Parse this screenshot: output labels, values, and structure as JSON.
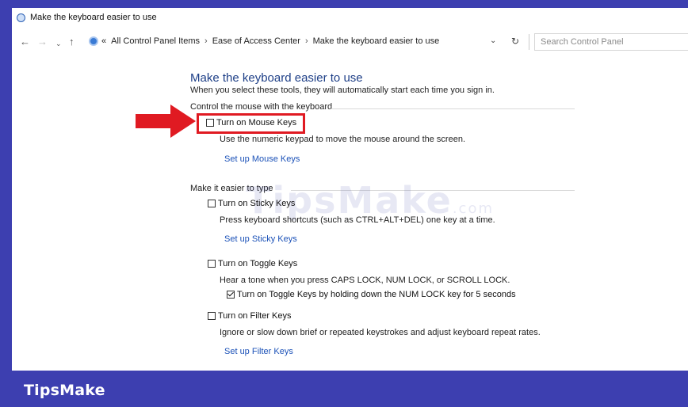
{
  "window": {
    "title": "Make the keyboard easier to use"
  },
  "nav": {
    "back_icon": "back-arrow-icon",
    "forward_icon": "forward-arrow-icon",
    "recent_icon": "chevron-down-icon",
    "up_icon": "up-arrow-icon"
  },
  "breadcrumb": {
    "overflow": "«",
    "items": [
      "All Control Panel Items",
      "Ease of Access Center",
      "Make the keyboard easier to use"
    ]
  },
  "search": {
    "placeholder": "Search Control Panel"
  },
  "page": {
    "title": "Make the keyboard easier to use",
    "description": "When you select these tools, they will automatically start each time you sign in."
  },
  "sections": {
    "mouse": {
      "heading": "Control the mouse with the keyboard",
      "mouse_keys": {
        "label": "Turn on Mouse Keys",
        "checked": false,
        "description": "Use the numeric keypad to move the mouse around the screen.",
        "link": "Set up Mouse Keys"
      }
    },
    "typing": {
      "heading": "Make it easier to type",
      "sticky_keys": {
        "label": "Turn on Sticky Keys",
        "checked": false,
        "description": "Press keyboard shortcuts (such as CTRL+ALT+DEL) one key at a time.",
        "link": "Set up Sticky Keys"
      },
      "toggle_keys": {
        "label": "Turn on Toggle Keys",
        "checked": false,
        "description": "Hear a tone when you press CAPS LOCK, NUM LOCK, or SCROLL LOCK.",
        "sub_option": {
          "label": "Turn on Toggle Keys by holding down the NUM LOCK key for 5 seconds",
          "checked": true
        }
      },
      "filter_keys": {
        "label": "Turn on Filter Keys",
        "checked": false,
        "description": "Ignore or slow down brief or repeated keystrokes and adjust keyboard repeat rates.",
        "link": "Set up Filter Keys"
      }
    }
  },
  "watermark": {
    "text": "TipsMake",
    "suffix": ".com"
  },
  "footer": {
    "brand": "TipsMake"
  },
  "colors": {
    "brand_bg": "#3d3fb0",
    "highlight_red": "#e01a22",
    "link_blue": "#1c52b8",
    "title_blue": "#1e3f87"
  }
}
